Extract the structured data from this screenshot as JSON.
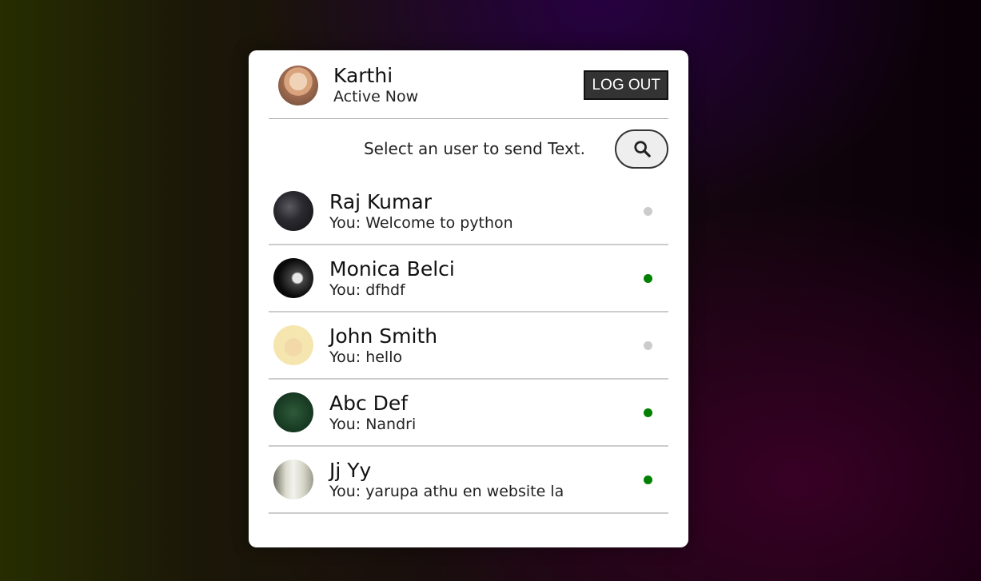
{
  "me": {
    "name": "Karthi",
    "status": "Active Now",
    "logout_label": "LOG OUT"
  },
  "search": {
    "prompt": "Select an user to send Text."
  },
  "colors": {
    "online": "#008000",
    "offline": "#cccccc"
  },
  "users": [
    {
      "name": "Raj Kumar",
      "message": "You: Welcome to python",
      "status": "offline"
    },
    {
      "name": "Monica Belci",
      "message": "You: dfhdf",
      "status": "online"
    },
    {
      "name": "John Smith",
      "message": "You: hello",
      "status": "offline"
    },
    {
      "name": "Abc Def",
      "message": "You: Nandri",
      "status": "online"
    },
    {
      "name": "Jj Yy",
      "message": "You: yarupa athu en website la",
      "status": "online"
    }
  ]
}
